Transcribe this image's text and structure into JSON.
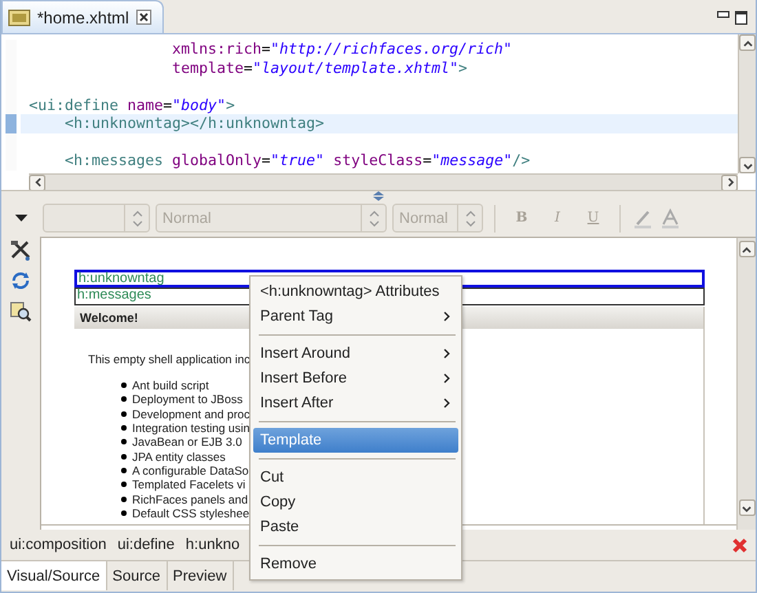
{
  "editor_tab": {
    "title": "*home.xhtml",
    "selected": true
  },
  "source_lines": [
    {
      "current": false,
      "tokens": [
        {
          "kind": "attr",
          "text": "                xmlns:rich"
        },
        {
          "kind": "plain",
          "text": "="
        },
        {
          "kind": "value",
          "text": "\"http://richfaces.org/rich\""
        }
      ]
    },
    {
      "current": false,
      "tokens": [
        {
          "kind": "attr",
          "text": "                template"
        },
        {
          "kind": "plain",
          "text": "="
        },
        {
          "kind": "value",
          "text": "\"layout/template.xhtml\""
        },
        {
          "kind": "tag",
          "text": ">"
        }
      ]
    },
    {
      "current": false
    },
    {
      "current": false,
      "tokens": [
        {
          "kind": "tag",
          "text": "<ui:define"
        },
        {
          "kind": "attr",
          "text": " name"
        },
        {
          "kind": "plain",
          "text": "="
        },
        {
          "kind": "value",
          "text": "\"body\""
        },
        {
          "kind": "tag",
          "text": ">"
        }
      ]
    },
    {
      "current": true,
      "tokens": [
        {
          "kind": "tag",
          "text": "    <h:unknowntag></h:unknowntag>"
        }
      ]
    },
    {
      "current": false
    },
    {
      "current": false,
      "tokens": [
        {
          "kind": "tag",
          "text": "    <h:messages"
        },
        {
          "kind": "attr",
          "text": " globalOnly"
        },
        {
          "kind": "plain",
          "text": "="
        },
        {
          "kind": "value",
          "text": "\"true\""
        },
        {
          "kind": "attr",
          "text": " styleClass"
        },
        {
          "kind": "plain",
          "text": "="
        },
        {
          "kind": "value",
          "text": "\"message\""
        },
        {
          "kind": "tag",
          "text": "/>"
        }
      ]
    }
  ],
  "toolbar": {
    "combos": [
      {
        "disabled": true
      },
      {
        "value": "Normal",
        "disabled": true
      },
      {
        "value": "Normal",
        "disabled": true
      }
    ],
    "format_buttons": [
      {
        "label": "B",
        "kind": "bold",
        "disabled": true
      },
      {
        "label": "I",
        "kind": "italic",
        "disabled": true
      },
      {
        "label": "U",
        "kind": "underline",
        "disabled": true
      }
    ]
  },
  "visual": {
    "tags": [
      {
        "label": "h:unknowntag",
        "selected": true
      },
      {
        "label": "h:messages",
        "selected": false
      }
    ],
    "panel": {
      "header": "Welcome!",
      "intro": "This empty shell application inc",
      "items": [
        "Ant build script",
        "Deployment to JBoss",
        "Development and proc",
        "Integration testing usin",
        "JavaBean or EJB 3.0",
        "JPA entity classes",
        "A configurable DataSo",
        "Templated Facelets vi",
        "RichFaces panels and",
        "Default CSS styleshee"
      ]
    }
  },
  "breadcrumb": [
    "ui:composition",
    "ui:define",
    "h:unkno"
  ],
  "bottom_tabs": [
    {
      "label": "Visual/Source",
      "selected": true
    },
    {
      "label": "Source",
      "selected": false
    },
    {
      "label": "Preview",
      "selected": false
    }
  ],
  "context_menu": [
    {
      "kind": "item",
      "label": "<h:unknowntag> Attributes",
      "submenu": false,
      "selected": false
    },
    {
      "kind": "item",
      "label": "Parent Tag",
      "submenu": true,
      "selected": false
    },
    {
      "kind": "separator"
    },
    {
      "kind": "item",
      "label": "Insert Around",
      "submenu": true,
      "selected": false
    },
    {
      "kind": "item",
      "label": "Insert Before",
      "submenu": true,
      "selected": false
    },
    {
      "kind": "item",
      "label": "Insert After",
      "submenu": true,
      "selected": false
    },
    {
      "kind": "separator"
    },
    {
      "kind": "item",
      "label": "Template",
      "submenu": false,
      "selected": true
    },
    {
      "kind": "separator"
    },
    {
      "kind": "item",
      "label": "Cut",
      "submenu": false,
      "selected": false
    },
    {
      "kind": "item",
      "label": "Copy",
      "submenu": false,
      "selected": false
    },
    {
      "kind": "item",
      "label": "Paste",
      "submenu": false,
      "selected": false
    },
    {
      "kind": "separator"
    },
    {
      "kind": "item",
      "label": "Remove",
      "submenu": false,
      "selected": false
    }
  ]
}
